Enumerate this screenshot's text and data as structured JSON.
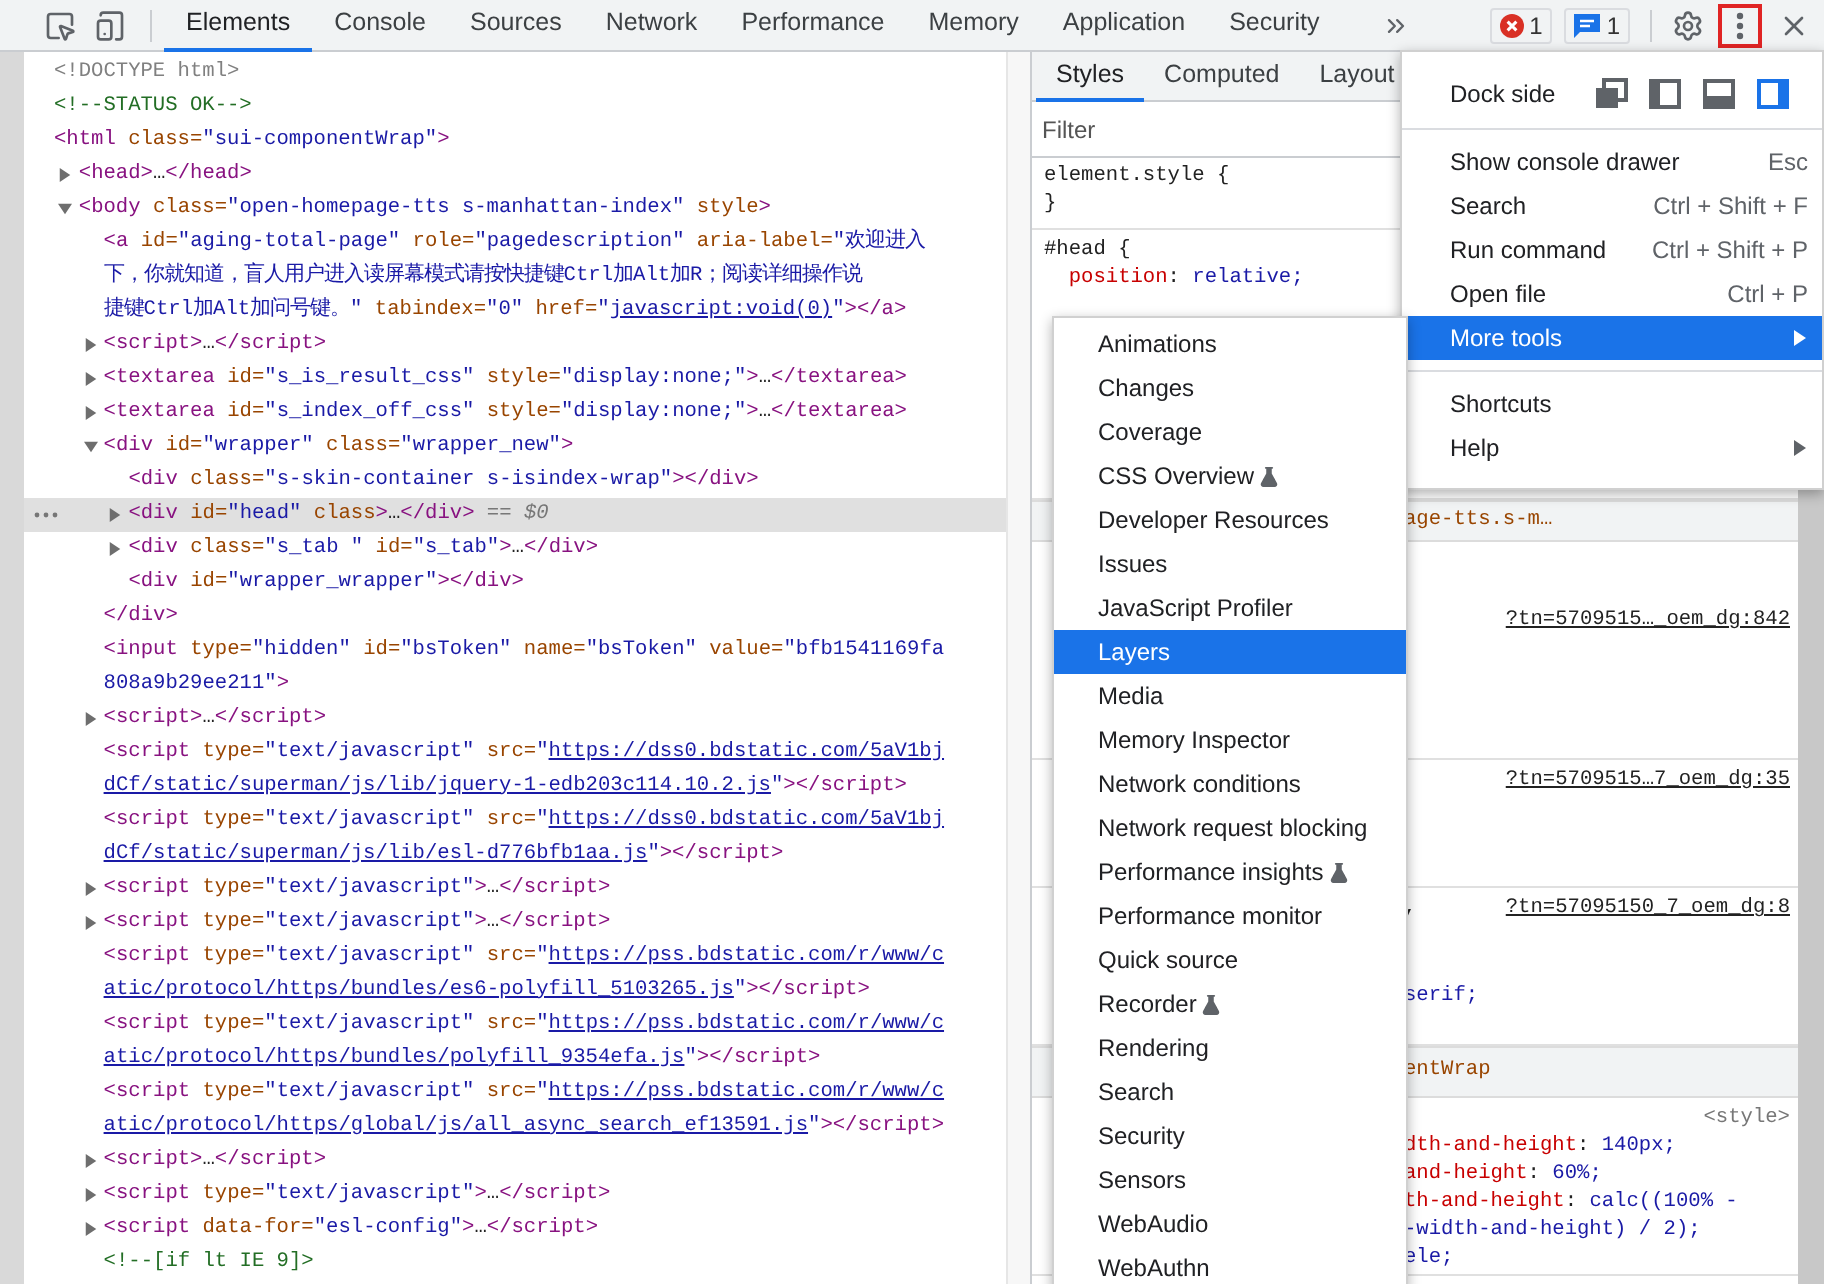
{
  "toolbar": {
    "tabs": [
      {
        "label": "Elements",
        "selected": true
      },
      {
        "label": "Console",
        "selected": false
      },
      {
        "label": "Sources",
        "selected": false
      },
      {
        "label": "Network",
        "selected": false
      },
      {
        "label": "Performance",
        "selected": false
      },
      {
        "label": "Memory",
        "selected": false
      },
      {
        "label": "Application",
        "selected": false
      },
      {
        "label": "Security",
        "selected": false
      }
    ],
    "badges": [
      {
        "kind": "error",
        "count": "1"
      },
      {
        "kind": "message",
        "count": "1"
      }
    ],
    "menu_button": {
      "highlighted": true
    }
  },
  "dom": [
    {
      "selected": false,
      "lines": [
        [
          {
            "kind": "doctype",
            "text": "<!DOCTYPE html>"
          }
        ]
      ]
    },
    {
      "selected": false,
      "lines": [
        [
          {
            "kind": "comment",
            "text": "<!--STATUS OK-->"
          }
        ]
      ]
    },
    {
      "selected": false,
      "lines": [
        [
          {
            "kind": "tag",
            "text": "<html "
          },
          {
            "kind": "attr",
            "text": "class="
          },
          {
            "kind": "value",
            "text": "\"sui-componentWrap\""
          },
          {
            "kind": "tag",
            "text": ">"
          }
        ]
      ],
      "children": [
        {
          "expanded": false,
          "selected": false,
          "lines": [
            [
              {
                "kind": "tag",
                "text": "<head>"
              },
              {
                "kind": "text",
                "text": "…"
              },
              {
                "kind": "tag",
                "text": "</head>"
              }
            ]
          ]
        },
        {
          "expanded": true,
          "selected": false,
          "lines": [
            [
              {
                "kind": "tag",
                "text": "<body "
              },
              {
                "kind": "attr",
                "text": "class="
              },
              {
                "kind": "value",
                "text": "\"open-homepage-tts s-manhattan-index\""
              },
              {
                "kind": "attr",
                "text": " style"
              },
              {
                "kind": "tag",
                "text": ">"
              }
            ]
          ],
          "children": [
            {
              "selected": false,
              "lines": [
                [
                  {
                    "kind": "tag",
                    "text": "<a "
                  },
                  {
                    "kind": "attr",
                    "text": "id="
                  },
                  {
                    "kind": "value",
                    "text": "\"aging-total-page\""
                  },
                  {
                    "kind": "attr",
                    "text": " role="
                  },
                  {
                    "kind": "value",
                    "text": "\"pagedescription\""
                  },
                  {
                    "kind": "attr",
                    "text": " aria-label="
                  },
                  {
                    "kind": "value",
                    "text": "\"欢迎进入"
                  }
                ],
                [
                  {
                    "kind": "value",
                    "text": "下，你就知道，盲人用户进入读屏幕模式请按快捷键Ctrl加Alt加R；阅读详细操作说"
                  }
                ],
                [
                  {
                    "kind": "value",
                    "text": "捷键Ctrl加Alt加问号键。\""
                  },
                  {
                    "kind": "attr",
                    "text": " tabindex="
                  },
                  {
                    "kind": "value",
                    "text": "\"0\""
                  },
                  {
                    "kind": "attr",
                    "text": " href="
                  },
                  {
                    "kind": "value",
                    "text": "\""
                  },
                  {
                    "kind": "link",
                    "text": "javascript:void(0)"
                  },
                  {
                    "kind": "value",
                    "text": "\""
                  },
                  {
                    "kind": "tag",
                    "text": "></a>"
                  }
                ]
              ]
            },
            {
              "expanded": false,
              "selected": false,
              "lines": [
                [
                  {
                    "kind": "tag",
                    "text": "<script>"
                  },
                  {
                    "kind": "text",
                    "text": "…"
                  },
                  {
                    "kind": "tag",
                    "text": "</script>"
                  }
                ]
              ]
            },
            {
              "expanded": false,
              "selected": false,
              "lines": [
                [
                  {
                    "kind": "tag",
                    "text": "<textarea "
                  },
                  {
                    "kind": "attr",
                    "text": "id="
                  },
                  {
                    "kind": "value",
                    "text": "\"s_is_result_css\""
                  },
                  {
                    "kind": "attr",
                    "text": " style="
                  },
                  {
                    "kind": "value",
                    "text": "\"display:none;\""
                  },
                  {
                    "kind": "tag",
                    "text": ">"
                  },
                  {
                    "kind": "text",
                    "text": "…"
                  },
                  {
                    "kind": "tag",
                    "text": "</textarea>"
                  }
                ]
              ]
            },
            {
              "expanded": false,
              "selected": false,
              "lines": [
                [
                  {
                    "kind": "tag",
                    "text": "<textarea "
                  },
                  {
                    "kind": "attr",
                    "text": "id="
                  },
                  {
                    "kind": "value",
                    "text": "\"s_index_off_css\""
                  },
                  {
                    "kind": "attr",
                    "text": " style="
                  },
                  {
                    "kind": "value",
                    "text": "\"display:none;\""
                  },
                  {
                    "kind": "tag",
                    "text": ">"
                  },
                  {
                    "kind": "text",
                    "text": "…"
                  },
                  {
                    "kind": "tag",
                    "text": "</textarea>"
                  }
                ]
              ]
            },
            {
              "expanded": true,
              "selected": false,
              "lines": [
                [
                  {
                    "kind": "tag",
                    "text": "<div "
                  },
                  {
                    "kind": "attr",
                    "text": "id="
                  },
                  {
                    "kind": "value",
                    "text": "\"wrapper\""
                  },
                  {
                    "kind": "attr",
                    "text": " class="
                  },
                  {
                    "kind": "value",
                    "text": "\"wrapper_new\""
                  },
                  {
                    "kind": "tag",
                    "text": ">"
                  }
                ]
              ],
              "children": [
                {
                  "selected": false,
                  "lines": [
                    [
                      {
                        "kind": "tag",
                        "text": "<div "
                      },
                      {
                        "kind": "attr",
                        "text": "class="
                      },
                      {
                        "kind": "value",
                        "text": "\"s-skin-container s-isindex-wrap\""
                      },
                      {
                        "kind": "tag",
                        "text": "></div>"
                      }
                    ]
                  ]
                },
                {
                  "expanded": false,
                  "selected": true,
                  "lines": [
                    [
                      {
                        "kind": "tag",
                        "text": "<div "
                      },
                      {
                        "kind": "attr",
                        "text": "id="
                      },
                      {
                        "kind": "value",
                        "text": "\"head\""
                      },
                      {
                        "kind": "attr",
                        "text": " class"
                      },
                      {
                        "kind": "tag",
                        "text": ">"
                      },
                      {
                        "kind": "text",
                        "text": "…"
                      },
                      {
                        "kind": "tag",
                        "text": "</div>"
                      },
                      {
                        "kind": "dollar",
                        "text": " == $0"
                      }
                    ]
                  ]
                },
                {
                  "expanded": false,
                  "selected": false,
                  "lines": [
                    [
                      {
                        "kind": "tag",
                        "text": "<div "
                      },
                      {
                        "kind": "attr",
                        "text": "class="
                      },
                      {
                        "kind": "value",
                        "text": "\"s_tab \""
                      },
                      {
                        "kind": "attr",
                        "text": " id="
                      },
                      {
                        "kind": "value",
                        "text": "\"s_tab\""
                      },
                      {
                        "kind": "tag",
                        "text": ">"
                      },
                      {
                        "kind": "text",
                        "text": "…"
                      },
                      {
                        "kind": "tag",
                        "text": "</div>"
                      }
                    ]
                  ]
                },
                {
                  "selected": false,
                  "lines": [
                    [
                      {
                        "kind": "tag",
                        "text": "<div "
                      },
                      {
                        "kind": "attr",
                        "text": "id="
                      },
                      {
                        "kind": "value",
                        "text": "\"wrapper_wrapper\""
                      },
                      {
                        "kind": "tag",
                        "text": "></div>"
                      }
                    ]
                  ]
                }
              ],
              "closing": [
                [
                  {
                    "kind": "tag",
                    "text": "</div>"
                  }
                ]
              ]
            },
            {
              "selected": false,
              "lines": [
                [
                  {
                    "kind": "tag",
                    "text": "<input "
                  },
                  {
                    "kind": "attr",
                    "text": "type="
                  },
                  {
                    "kind": "value",
                    "text": "\"hidden\""
                  },
                  {
                    "kind": "attr",
                    "text": " id="
                  },
                  {
                    "kind": "value",
                    "text": "\"bsToken\""
                  },
                  {
                    "kind": "attr",
                    "text": " name="
                  },
                  {
                    "kind": "value",
                    "text": "\"bsToken\""
                  },
                  {
                    "kind": "attr",
                    "text": " value="
                  },
                  {
                    "kind": "value",
                    "text": "\"bfb1541169fa"
                  }
                ],
                [
                  {
                    "kind": "value",
                    "text": "808a9b29ee211\""
                  },
                  {
                    "kind": "tag",
                    "text": ">"
                  }
                ]
              ]
            },
            {
              "expanded": false,
              "selected": false,
              "lines": [
                [
                  {
                    "kind": "tag",
                    "text": "<script>"
                  },
                  {
                    "kind": "text",
                    "text": "…"
                  },
                  {
                    "kind": "tag",
                    "text": "</script>"
                  }
                ]
              ]
            },
            {
              "selected": false,
              "lines": [
                [
                  {
                    "kind": "tag",
                    "text": "<script "
                  },
                  {
                    "kind": "attr",
                    "text": "type="
                  },
                  {
                    "kind": "value",
                    "text": "\"text/javascript\""
                  },
                  {
                    "kind": "attr",
                    "text": " src="
                  },
                  {
                    "kind": "value",
                    "text": "\""
                  },
                  {
                    "kind": "link",
                    "text": "https://dss0.bdstatic.com/5aV1bj"
                  }
                ],
                [
                  {
                    "kind": "link",
                    "text": "dCf/static/superman/js/lib/jquery-1-edb203c114.10.2.js"
                  },
                  {
                    "kind": "value",
                    "text": "\""
                  },
                  {
                    "kind": "tag",
                    "text": "></script>"
                  }
                ]
              ]
            },
            {
              "selected": false,
              "lines": [
                [
                  {
                    "kind": "tag",
                    "text": "<script "
                  },
                  {
                    "kind": "attr",
                    "text": "type="
                  },
                  {
                    "kind": "value",
                    "text": "\"text/javascript\""
                  },
                  {
                    "kind": "attr",
                    "text": " src="
                  },
                  {
                    "kind": "value",
                    "text": "\""
                  },
                  {
                    "kind": "link",
                    "text": "https://dss0.bdstatic.com/5aV1bj"
                  }
                ],
                [
                  {
                    "kind": "link",
                    "text": "dCf/static/superman/js/lib/esl-d776bfb1aa.js"
                  },
                  {
                    "kind": "value",
                    "text": "\""
                  },
                  {
                    "kind": "tag",
                    "text": "></script>"
                  }
                ]
              ]
            },
            {
              "expanded": false,
              "selected": false,
              "lines": [
                [
                  {
                    "kind": "tag",
                    "text": "<script "
                  },
                  {
                    "kind": "attr",
                    "text": "type="
                  },
                  {
                    "kind": "value",
                    "text": "\"text/javascript\""
                  },
                  {
                    "kind": "tag",
                    "text": ">"
                  },
                  {
                    "kind": "text",
                    "text": "…"
                  },
                  {
                    "kind": "tag",
                    "text": "</script>"
                  }
                ]
              ]
            },
            {
              "expanded": false,
              "selected": false,
              "lines": [
                [
                  {
                    "kind": "tag",
                    "text": "<script "
                  },
                  {
                    "kind": "attr",
                    "text": "type="
                  },
                  {
                    "kind": "value",
                    "text": "\"text/javascript\""
                  },
                  {
                    "kind": "tag",
                    "text": ">"
                  },
                  {
                    "kind": "text",
                    "text": "…"
                  },
                  {
                    "kind": "tag",
                    "text": "</script>"
                  }
                ]
              ]
            },
            {
              "selected": false,
              "lines": [
                [
                  {
                    "kind": "tag",
                    "text": "<script "
                  },
                  {
                    "kind": "attr",
                    "text": "type="
                  },
                  {
                    "kind": "value",
                    "text": "\"text/javascript\""
                  },
                  {
                    "kind": "attr",
                    "text": " src="
                  },
                  {
                    "kind": "value",
                    "text": "\""
                  },
                  {
                    "kind": "link",
                    "text": "https://pss.bdstatic.com/r/www/c"
                  }
                ],
                [
                  {
                    "kind": "link",
                    "text": "atic/protocol/https/bundles/es6-polyfill_5103265.js"
                  },
                  {
                    "kind": "value",
                    "text": "\""
                  },
                  {
                    "kind": "tag",
                    "text": "></script>"
                  }
                ]
              ]
            },
            {
              "selected": false,
              "lines": [
                [
                  {
                    "kind": "tag",
                    "text": "<script "
                  },
                  {
                    "kind": "attr",
                    "text": "type="
                  },
                  {
                    "kind": "value",
                    "text": "\"text/javascript\""
                  },
                  {
                    "kind": "attr",
                    "text": " src="
                  },
                  {
                    "kind": "value",
                    "text": "\""
                  },
                  {
                    "kind": "link",
                    "text": "https://pss.bdstatic.com/r/www/c"
                  }
                ],
                [
                  {
                    "kind": "link",
                    "text": "atic/protocol/https/bundles/polyfill_9354efa.js"
                  },
                  {
                    "kind": "value",
                    "text": "\""
                  },
                  {
                    "kind": "tag",
                    "text": "></script>"
                  }
                ]
              ]
            },
            {
              "selected": false,
              "lines": [
                [
                  {
                    "kind": "tag",
                    "text": "<script "
                  },
                  {
                    "kind": "attr",
                    "text": "type="
                  },
                  {
                    "kind": "value",
                    "text": "\"text/javascript\""
                  },
                  {
                    "kind": "attr",
                    "text": " src="
                  },
                  {
                    "kind": "value",
                    "text": "\""
                  },
                  {
                    "kind": "link",
                    "text": "https://pss.bdstatic.com/r/www/c"
                  }
                ],
                [
                  {
                    "kind": "link",
                    "text": "atic/protocol/https/global/js/all_async_search_ef13591.js"
                  },
                  {
                    "kind": "value",
                    "text": "\""
                  },
                  {
                    "kind": "tag",
                    "text": "></script>"
                  }
                ]
              ]
            },
            {
              "expanded": false,
              "selected": false,
              "lines": [
                [
                  {
                    "kind": "tag",
                    "text": "<script>"
                  },
                  {
                    "kind": "text",
                    "text": "…"
                  },
                  {
                    "kind": "tag",
                    "text": "</script>"
                  }
                ]
              ]
            },
            {
              "expanded": false,
              "selected": false,
              "lines": [
                [
                  {
                    "kind": "tag",
                    "text": "<script "
                  },
                  {
                    "kind": "attr",
                    "text": "type="
                  },
                  {
                    "kind": "value",
                    "text": "\"text/javascript\""
                  },
                  {
                    "kind": "tag",
                    "text": ">"
                  },
                  {
                    "kind": "text",
                    "text": "…"
                  },
                  {
                    "kind": "tag",
                    "text": "</script>"
                  }
                ]
              ]
            },
            {
              "expanded": false,
              "selected": false,
              "lines": [
                [
                  {
                    "kind": "tag",
                    "text": "<script "
                  },
                  {
                    "kind": "attr",
                    "text": "data-for="
                  },
                  {
                    "kind": "value",
                    "text": "\"esl-config\""
                  },
                  {
                    "kind": "tag",
                    "text": ">"
                  },
                  {
                    "kind": "text",
                    "text": "…"
                  },
                  {
                    "kind": "tag",
                    "text": "</script>"
                  }
                ]
              ]
            },
            {
              "selected": false,
              "lines": [
                [
                  {
                    "kind": "comment",
                    "text": "<!--[if lt IE 9]>"
                  }
                ]
              ]
            }
          ]
        }
      ]
    }
  ],
  "styles_pane": {
    "tabs": [
      {
        "label": "Styles",
        "selected": true
      },
      {
        "label": "Computed",
        "selected": false
      },
      {
        "label": "Layout",
        "selected": false
      }
    ],
    "filter": {
      "placeholder": "Filter"
    },
    "blocks": [
      {
        "kind": "rule",
        "lines": [
          [
            {
              "kind": "selector",
              "text": "element.style {"
            }
          ],
          [
            {
              "kind": "punct",
              "text": "}"
            }
          ]
        ]
      },
      {
        "kind": "rule",
        "lines": [
          [
            {
              "kind": "selector",
              "text": "#head {"
            }
          ],
          [
            {
              "kind": "prop",
              "text": "  position"
            },
            {
              "kind": "punct",
              "text": ": "
            },
            {
              "kind": "value",
              "text": "relative;"
            }
          ]
        ]
      },
      {
        "kind": "band",
        "text": "age-tts.s-m…"
      },
      {
        "kind": "rule",
        "source": {
          "kind": "link",
          "text": "?tn=5709515…_oem_dg:842"
        }
      },
      {
        "kind": "rule",
        "source": {
          "kind": "link",
          "text": "?tn=5709515…7_oem_dg:35"
        }
      },
      {
        "kind": "rule_inline",
        "source": {
          "kind": "link",
          "text": "?tn=57095150_7_oem_dg:8"
        },
        "lines": [
          [
            {
              "kind": "punct",
              "text": ","
            }
          ],
          [
            {
              "kind": "value",
              "text": "serif;"
            }
          ]
        ]
      },
      {
        "kind": "band",
        "text": "entWrap"
      },
      {
        "kind": "rule",
        "source": {
          "kind": "tag",
          "text": "<style>"
        },
        "lines": [
          [
            {
              "kind": "prop",
              "text": "dth-and-height"
            },
            {
              "kind": "punct",
              "text": ": "
            },
            {
              "kind": "value",
              "text": "140px;"
            }
          ],
          [
            {
              "kind": "prop",
              "text": "and-height"
            },
            {
              "kind": "punct",
              "text": ": "
            },
            {
              "kind": "value",
              "text": "60%;"
            }
          ],
          [
            {
              "kind": "prop",
              "text": "th-and-height"
            },
            {
              "kind": "punct",
              "text": ": "
            },
            {
              "kind": "value",
              "text": "calc((100% -"
            }
          ],
          [
            {
              "kind": "var",
              "text": "-width-and-height"
            },
            {
              "kind": "value",
              "text": ") / 2);"
            }
          ],
          [
            {
              "kind": "value",
              "text": "ele;"
            }
          ]
        ]
      }
    ]
  },
  "main_menu": {
    "dock_side": {
      "label": "Dock side",
      "options": [
        {
          "kind": "undock",
          "selected": false
        },
        {
          "kind": "left",
          "selected": false
        },
        {
          "kind": "bottom",
          "selected": false
        },
        {
          "kind": "right",
          "selected": true
        }
      ]
    },
    "groups": [
      [
        {
          "label": "Show console drawer",
          "shortcut": "Esc",
          "submenu": false,
          "selected": false
        },
        {
          "label": "Search",
          "shortcut": "Ctrl + Shift + F",
          "submenu": false,
          "selected": false
        },
        {
          "label": "Run command",
          "shortcut": "Ctrl + Shift + P",
          "submenu": false,
          "selected": false
        },
        {
          "label": "Open file",
          "shortcut": "Ctrl + P",
          "submenu": false,
          "selected": false
        },
        {
          "label": "More tools",
          "submenu": true,
          "selected": true
        }
      ],
      [
        {
          "label": "Shortcuts",
          "submenu": false,
          "selected": false
        },
        {
          "label": "Help",
          "submenu": true,
          "selected": false
        }
      ]
    ]
  },
  "more_tools_menu": {
    "items": [
      {
        "label": "Animations",
        "experimental": false,
        "selected": false
      },
      {
        "label": "Changes",
        "experimental": false,
        "selected": false
      },
      {
        "label": "Coverage",
        "experimental": false,
        "selected": false
      },
      {
        "label": "CSS Overview",
        "experimental": true,
        "selected": false
      },
      {
        "label": "Developer Resources",
        "experimental": false,
        "selected": false
      },
      {
        "label": "Issues",
        "experimental": false,
        "selected": false
      },
      {
        "label": "JavaScript Profiler",
        "experimental": false,
        "selected": false
      },
      {
        "label": "Layers",
        "experimental": false,
        "selected": true
      },
      {
        "label": "Media",
        "experimental": false,
        "selected": false
      },
      {
        "label": "Memory Inspector",
        "experimental": false,
        "selected": false
      },
      {
        "label": "Network conditions",
        "experimental": false,
        "selected": false
      },
      {
        "label": "Network request blocking",
        "experimental": false,
        "selected": false
      },
      {
        "label": "Performance insights",
        "experimental": true,
        "selected": false
      },
      {
        "label": "Performance monitor",
        "experimental": false,
        "selected": false
      },
      {
        "label": "Quick source",
        "experimental": false,
        "selected": false
      },
      {
        "label": "Recorder",
        "experimental": true,
        "selected": false
      },
      {
        "label": "Rendering",
        "experimental": false,
        "selected": false
      },
      {
        "label": "Search",
        "experimental": false,
        "selected": false
      },
      {
        "label": "Security",
        "experimental": false,
        "selected": false
      },
      {
        "label": "Sensors",
        "experimental": false,
        "selected": false
      },
      {
        "label": "WebAudio",
        "experimental": false,
        "selected": false
      },
      {
        "label": "WebAuthn",
        "experimental": false,
        "selected": false
      }
    ]
  }
}
